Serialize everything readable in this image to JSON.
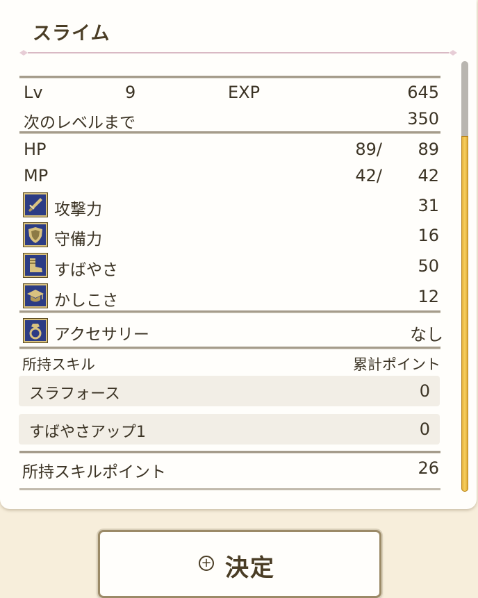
{
  "header": {
    "title": "スライム"
  },
  "stats": {
    "lv_label": "Lv",
    "lv_value": "9",
    "exp_label": "EXP",
    "exp_value": "645",
    "next_label": "次のレベルまで",
    "next_value": "350",
    "hp_label": "HP",
    "hp_current": "89/",
    "hp_max": "89",
    "mp_label": "MP",
    "mp_current": "42/",
    "mp_max": "42",
    "attributes": [
      {
        "label": "攻撃力",
        "value": "31",
        "icon": "sword-icon"
      },
      {
        "label": "守備力",
        "value": "16",
        "icon": "shield-icon"
      },
      {
        "label": "すばやさ",
        "value": "50",
        "icon": "boot-icon"
      },
      {
        "label": "かしこさ",
        "value": "12",
        "icon": "graduation-cap-icon"
      }
    ]
  },
  "accessory": {
    "label": "アクセサリー",
    "value": "なし",
    "icon": "ring-icon"
  },
  "skills": {
    "header_label": "所持スキル",
    "header_points": "累計ポイント",
    "items": [
      {
        "name": "スラフォース",
        "points": "0"
      },
      {
        "name": "すばやさアップ1",
        "points": "0"
      }
    ],
    "owned_points_label": "所持スキルポイント",
    "owned_points_value": "26"
  },
  "confirm_button": {
    "label": "決定",
    "icon": "plus-circle-icon"
  },
  "colors": {
    "accent_gold": "#e8b847",
    "icon_navy": "#2c3c84",
    "text": "#3b3324"
  }
}
